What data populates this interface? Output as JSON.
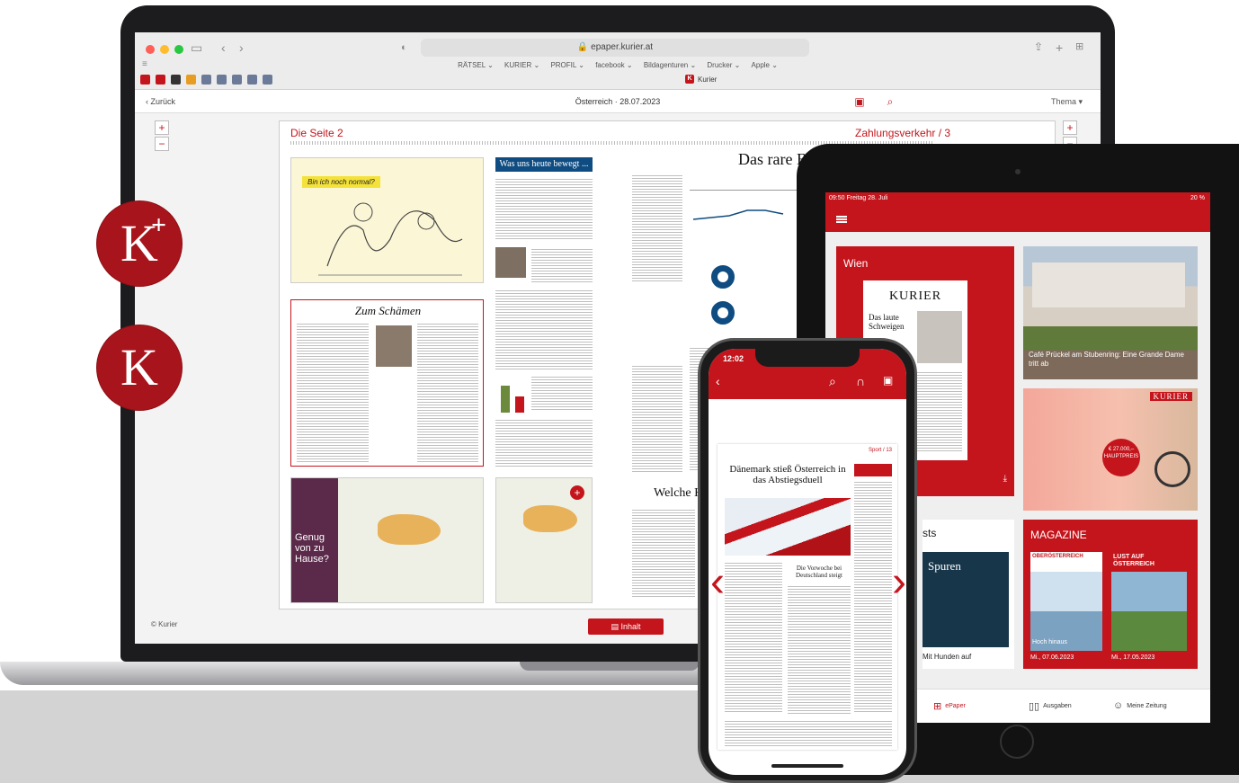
{
  "laptop": {
    "browser": {
      "url": "epaper.kurier.at",
      "bookmarks": [
        "RÄTSEL ⌄",
        "KURIER ⌄",
        "PROFIL ⌄",
        "facebook ⌄",
        "Bildagenturen ⌄",
        "Drucker ⌄",
        "Apple ⌄"
      ],
      "tab_title": "Kurier"
    },
    "app": {
      "back_label": "‹ Zurück",
      "issue_title": "Österreich · 28.07.2023",
      "topic_label": "Thema ▾",
      "zoom_in": "+",
      "zoom_out": "−",
      "contents_label": "Inhalt",
      "copyright": "© Kurier"
    },
    "paper": {
      "left_page_title": "Die Seite 2",
      "right_page_title": "Zahlungsverkehr / 3",
      "right_headline": "Das rare B",
      "banner": "Was uns heute bewegt ...",
      "cartoon_caption": "Bin ich noch normal?",
      "box_title": "Zum Schämen",
      "promo_lines": [
        "Genug",
        "von zu",
        "Hause?"
      ],
      "right_bottom_headline": "Welche K"
    }
  },
  "badges": {
    "plus": "K",
    "plus_sign": "+",
    "plain": "K"
  },
  "tablet": {
    "status_time": "09:50  Freitag 28. Juli",
    "battery": "20 %",
    "wien_label": "Wien",
    "wien_masthead": "KURIER",
    "wien_headline": "Das laute Schweigen",
    "street_caption": "Café Prückel am Stubenring: Eine Grande Dame tritt ab",
    "ad_brand": "KURIER",
    "ad_price": "€ 27.000,–",
    "ad_price_note": "HAUPTPREIS",
    "podcast_label": "sts",
    "podcast_title": "Spuren",
    "podcast_caption": "Mit Hunden auf",
    "magazine_label": "MAGAZINE",
    "magazine_covers": [
      {
        "title": "OBERÖSTERREICH",
        "subtitle": "Hoch hinaus",
        "date": "Mi., 07.06.2023"
      },
      {
        "title": "LUST AUF ÖSTERREICH",
        "subtitle": "",
        "date": "Mi., 17.05.2023"
      }
    ],
    "tabs": [
      {
        "label": "ePaper",
        "icon": "grid-icon",
        "active": true
      },
      {
        "label": "Ausgaben",
        "icon": "book-icon",
        "active": false
      },
      {
        "label": "Meine Zeitung",
        "icon": "person-icon",
        "active": false
      }
    ]
  },
  "phone": {
    "time": "12:02",
    "section": "Sport / 13",
    "headline": "Dänemark stieß Österreich in das Abstiegsduell",
    "sub_headline": "Die Vorwoche bei Deutschland steigt",
    "icons": [
      "back-arrow-icon",
      "search-icon",
      "headphones-icon",
      "image-icon"
    ]
  },
  "colors": {
    "brand_red": "#c4151c",
    "badge_red": "#a8141c",
    "device_black": "#1c1c1e"
  }
}
